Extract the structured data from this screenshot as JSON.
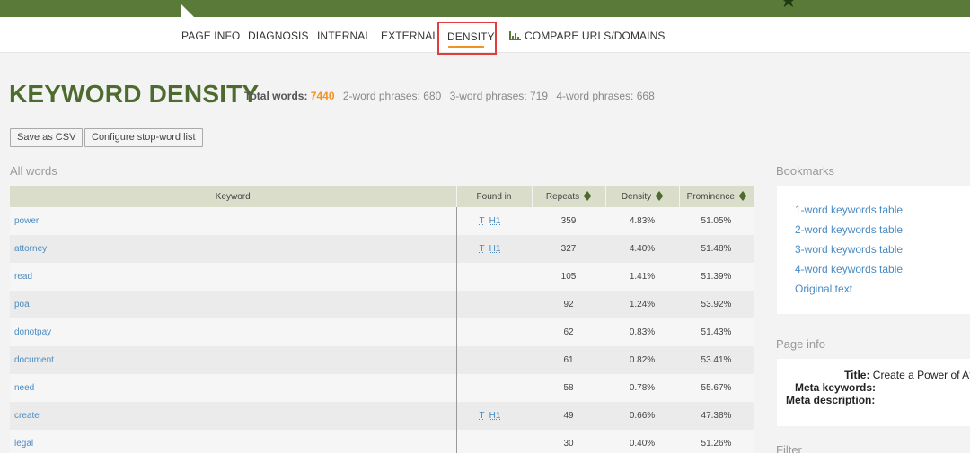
{
  "nav": {
    "items": [
      "PAGE INFO",
      "DIAGNOSIS",
      "INTERNAL",
      "EXTERNAL",
      "DENSITY",
      "COMPARE URLS/DOMAINS"
    ],
    "active": "DENSITY"
  },
  "header": {
    "title": "KEYWORD DENSITY",
    "total_label": "Total words:",
    "total_value": "7440",
    "two_word": "2-word phrases: 680",
    "three_word": "3-word phrases: 719",
    "four_word": "4-word phrases: 668"
  },
  "buttons": {
    "save_csv": "Save as CSV",
    "configure": "Configure stop-word list"
  },
  "all_words": {
    "label": "All words",
    "columns": [
      "Keyword",
      "Found in",
      "Repeats",
      "Density",
      "Prominence"
    ],
    "rows": [
      {
        "keyword": "power",
        "found": [
          "T",
          "H1"
        ],
        "repeats": "359",
        "density": "4.83%",
        "prominence": "51.05%"
      },
      {
        "keyword": "attorney",
        "found": [
          "T",
          "H1"
        ],
        "repeats": "327",
        "density": "4.40%",
        "prominence": "51.48%"
      },
      {
        "keyword": "read",
        "found": [],
        "repeats": "105",
        "density": "1.41%",
        "prominence": "51.39%"
      },
      {
        "keyword": "poa",
        "found": [],
        "repeats": "92",
        "density": "1.24%",
        "prominence": "53.92%"
      },
      {
        "keyword": "donotpay",
        "found": [],
        "repeats": "62",
        "density": "0.83%",
        "prominence": "51.43%"
      },
      {
        "keyword": "document",
        "found": [],
        "repeats": "61",
        "density": "0.82%",
        "prominence": "53.41%"
      },
      {
        "keyword": "need",
        "found": [],
        "repeats": "58",
        "density": "0.78%",
        "prominence": "55.67%"
      },
      {
        "keyword": "create",
        "found": [
          "T",
          "H1"
        ],
        "repeats": "49",
        "density": "0.66%",
        "prominence": "47.38%"
      },
      {
        "keyword": "legal",
        "found": [],
        "repeats": "30",
        "density": "0.40%",
        "prominence": "51.26%"
      }
    ]
  },
  "sidebar": {
    "bookmarks_label": "Bookmarks",
    "bookmarks": [
      "1-word keywords table",
      "2-word keywords table",
      "3-word keywords table",
      "4-word keywords table",
      "Original text"
    ],
    "page_info_label": "Page info",
    "page_info": {
      "title_label": "Title:",
      "title_value": "Create a Power of Att",
      "meta_keywords_label": "Meta keywords:",
      "meta_description_label": "Meta description:"
    },
    "filter_label": "Filter"
  },
  "colors": {
    "brand_green": "#4d6b2f",
    "topbar": "#5a7a3a",
    "accent_orange": "#f39221",
    "link_blue": "#4a8bc2",
    "highlight_red": "#e23d3d"
  }
}
